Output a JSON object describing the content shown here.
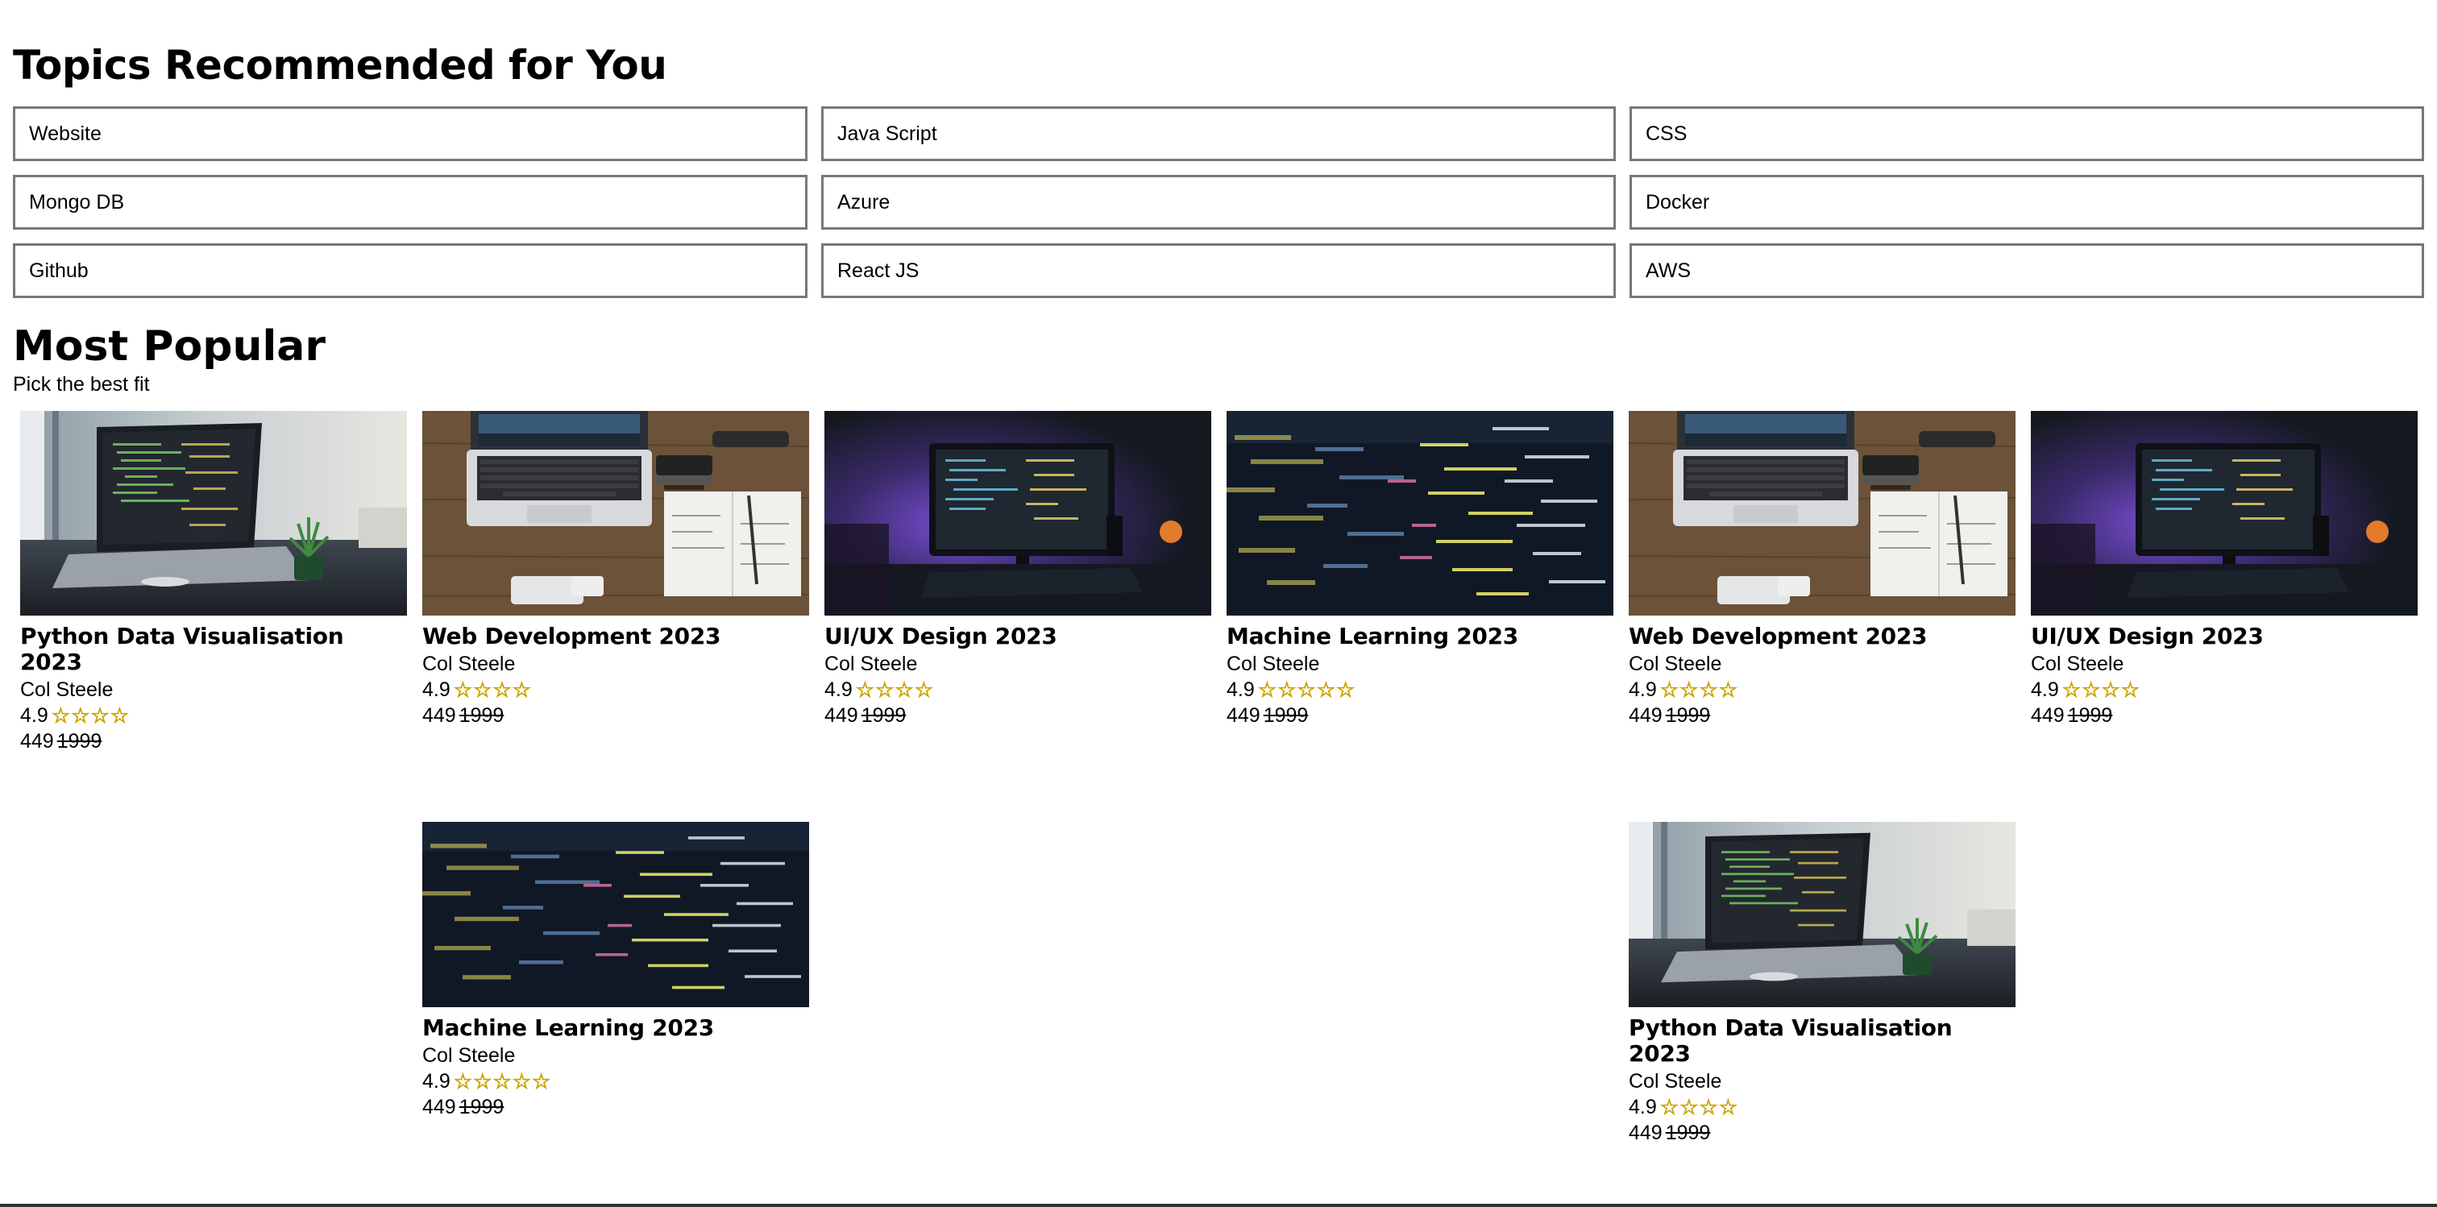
{
  "topics": {
    "heading": "Topics Recommended for You",
    "items": [
      "Website",
      "Java Script",
      "CSS",
      "Mongo DB",
      "Azure",
      "Docker",
      "Github",
      "React JS",
      "AWS"
    ]
  },
  "popular": {
    "heading": "Most Popular",
    "subtitle": "Pick the best fit",
    "courses": [
      {
        "title": "Python Data Visualisation 2023",
        "author": "Col Steele",
        "rating": "4.9",
        "stars": 4,
        "price": "449",
        "old_price": "1999",
        "image": "laptop-desk"
      },
      {
        "title": "Web Development 2023",
        "author": "Col Steele",
        "rating": "4.9",
        "stars": 4,
        "price": "449",
        "old_price": "1999",
        "image": "macbook-workspace"
      },
      {
        "title": "UI/UX Design 2023",
        "author": "Col Steele",
        "rating": "4.9",
        "stars": 4,
        "price": "449",
        "old_price": "1999",
        "image": "monitor-purple"
      },
      {
        "title": "Machine Learning 2023",
        "author": "Col Steele",
        "rating": "4.9",
        "stars": 5,
        "price": "449",
        "old_price": "1999",
        "image": "code-closeup"
      },
      {
        "title": "Web Development 2023",
        "author": "Col Steele",
        "rating": "4.9",
        "stars": 4,
        "price": "449",
        "old_price": "1999",
        "image": "macbook-workspace"
      },
      {
        "title": "UI/UX Design 2023",
        "author": "Col Steele",
        "rating": "4.9",
        "stars": 4,
        "price": "449",
        "old_price": "1999",
        "image": "monitor-purple"
      },
      {
        "title": "Machine Learning 2023",
        "author": "Col Steele",
        "rating": "4.9",
        "stars": 5,
        "price": "449",
        "old_price": "1999",
        "image": "code-closeup"
      },
      {
        "title": "Python Data Visualisation 2023",
        "author": "Col Steele",
        "rating": "4.9",
        "stars": 4,
        "price": "449",
        "old_price": "1999",
        "image": "laptop-desk"
      }
    ]
  }
}
